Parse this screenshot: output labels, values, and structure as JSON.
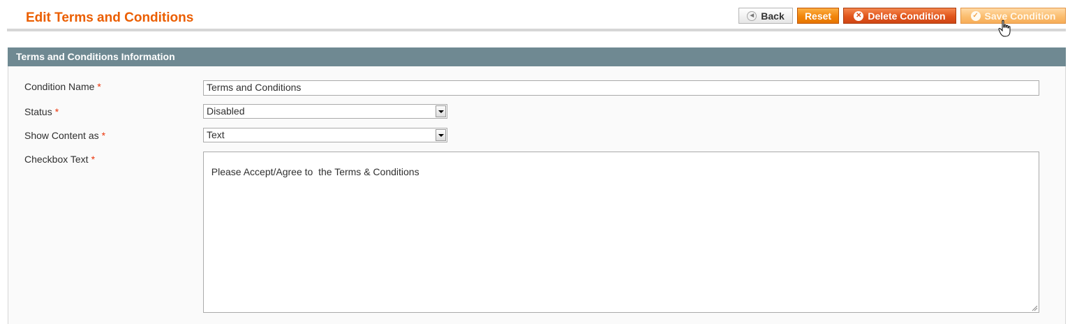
{
  "page": {
    "title": "Edit Terms and Conditions"
  },
  "toolbar": {
    "back_label": "Back",
    "reset_label": "Reset",
    "delete_label": "Delete Condition",
    "save_label": "Save Condition"
  },
  "section": {
    "title": "Terms and Conditions Information"
  },
  "form": {
    "required_mark": "*",
    "condition_name": {
      "label": "Condition Name",
      "value": "Terms and Conditions"
    },
    "status": {
      "label": "Status",
      "value": "Disabled"
    },
    "show_content_as": {
      "label": "Show Content as",
      "value": "Text"
    },
    "checkbox_text": {
      "label": "Checkbox Text",
      "value": "Please Accept/Agree to  the Terms & Conditions"
    }
  },
  "colors": {
    "title": "#eb5e00",
    "section_header": "#6f8992",
    "required": "#eb340a",
    "button_orange": "#f1850a",
    "button_delete": "#e1551b"
  },
  "icons": {
    "back": "chevron-left-icon",
    "delete": "close-circle-icon",
    "save": "check-circle-icon",
    "select_arrow": "chevron-down-icon",
    "cursor": "hand-pointer-icon"
  }
}
